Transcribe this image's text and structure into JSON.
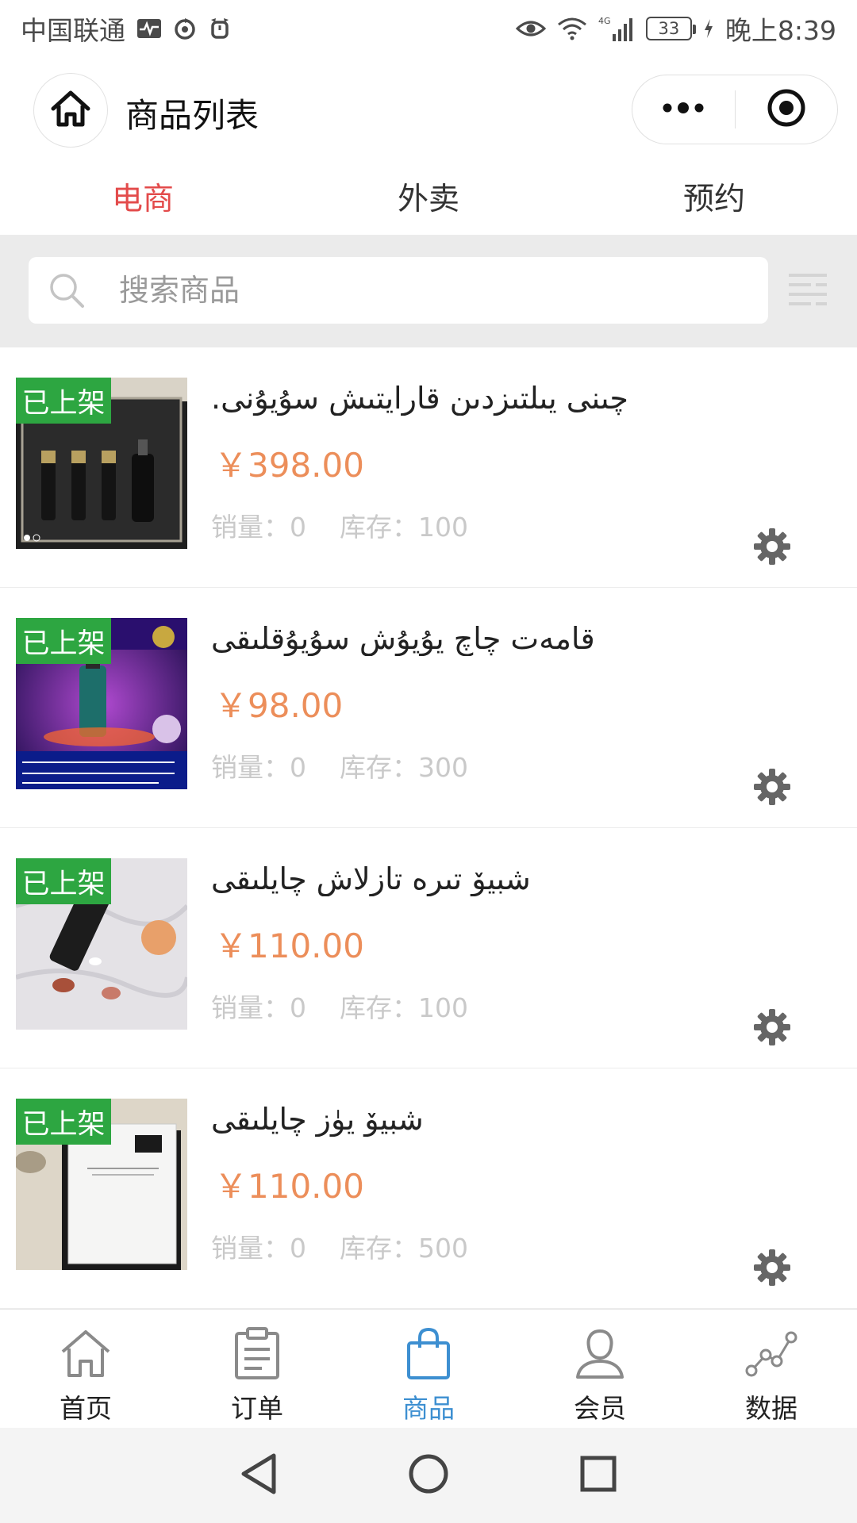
{
  "status_bar": {
    "carrier": "中国联通",
    "network": "4G",
    "battery": "33",
    "time": "晚上8:39"
  },
  "title_bar": {
    "title": "商品列表",
    "home_icon": "home-icon",
    "more_icon": "more-dots-icon",
    "close_icon": "target-close-icon"
  },
  "tabs": [
    {
      "label": "电商",
      "active": true
    },
    {
      "label": "外卖",
      "active": false
    },
    {
      "label": "预约",
      "active": false
    }
  ],
  "search": {
    "placeholder": "搜索商品",
    "value": ""
  },
  "products": [
    {
      "status": "已上架",
      "name": "چىنى يىلتىزدىن قارايتىش سۇيۇنى.",
      "price": "￥398.00",
      "sales_label": "销量：",
      "sales": "0",
      "stock_label": "库存：",
      "stock": "100",
      "image": "dark-bottles-gift-box"
    },
    {
      "status": "已上架",
      "name": "قامەت چاچ يۇيۇش سۇيۇقلىقى",
      "price": "￥98.00",
      "sales_label": "销量：",
      "sales": "0",
      "stock_label": "库存：",
      "stock": "300",
      "image": "purple-promo-bottle"
    },
    {
      "status": "已上架",
      "name": "شبيۆ تىرە تازلاش چايلىقى",
      "price": "￥110.00",
      "sales_label": "销量：",
      "sales": "0",
      "stock_label": "库存：",
      "stock": "100",
      "image": "tube-with-seashells"
    },
    {
      "status": "已上架",
      "name": "شبيۆ يۈز چايلىقى",
      "price": "￥110.00",
      "sales_label": "销量：",
      "sales": "0",
      "stock_label": "库存：",
      "stock": "500",
      "image": "white-box-packaging"
    }
  ],
  "bottom_nav": [
    {
      "label": "首页",
      "icon": "house-icon",
      "active": false
    },
    {
      "label": "订单",
      "icon": "clipboard-icon",
      "active": false
    },
    {
      "label": "商品",
      "icon": "shopping-bag-icon",
      "active": true
    },
    {
      "label": "会员",
      "icon": "user-icon",
      "active": false
    },
    {
      "label": "数据",
      "icon": "line-chart-icon",
      "active": false
    }
  ],
  "colors": {
    "tab_active": "#e34b4b",
    "price": "#ec8e5a",
    "badge": "#2da641",
    "bottom_active": "#3d8fd1"
  }
}
